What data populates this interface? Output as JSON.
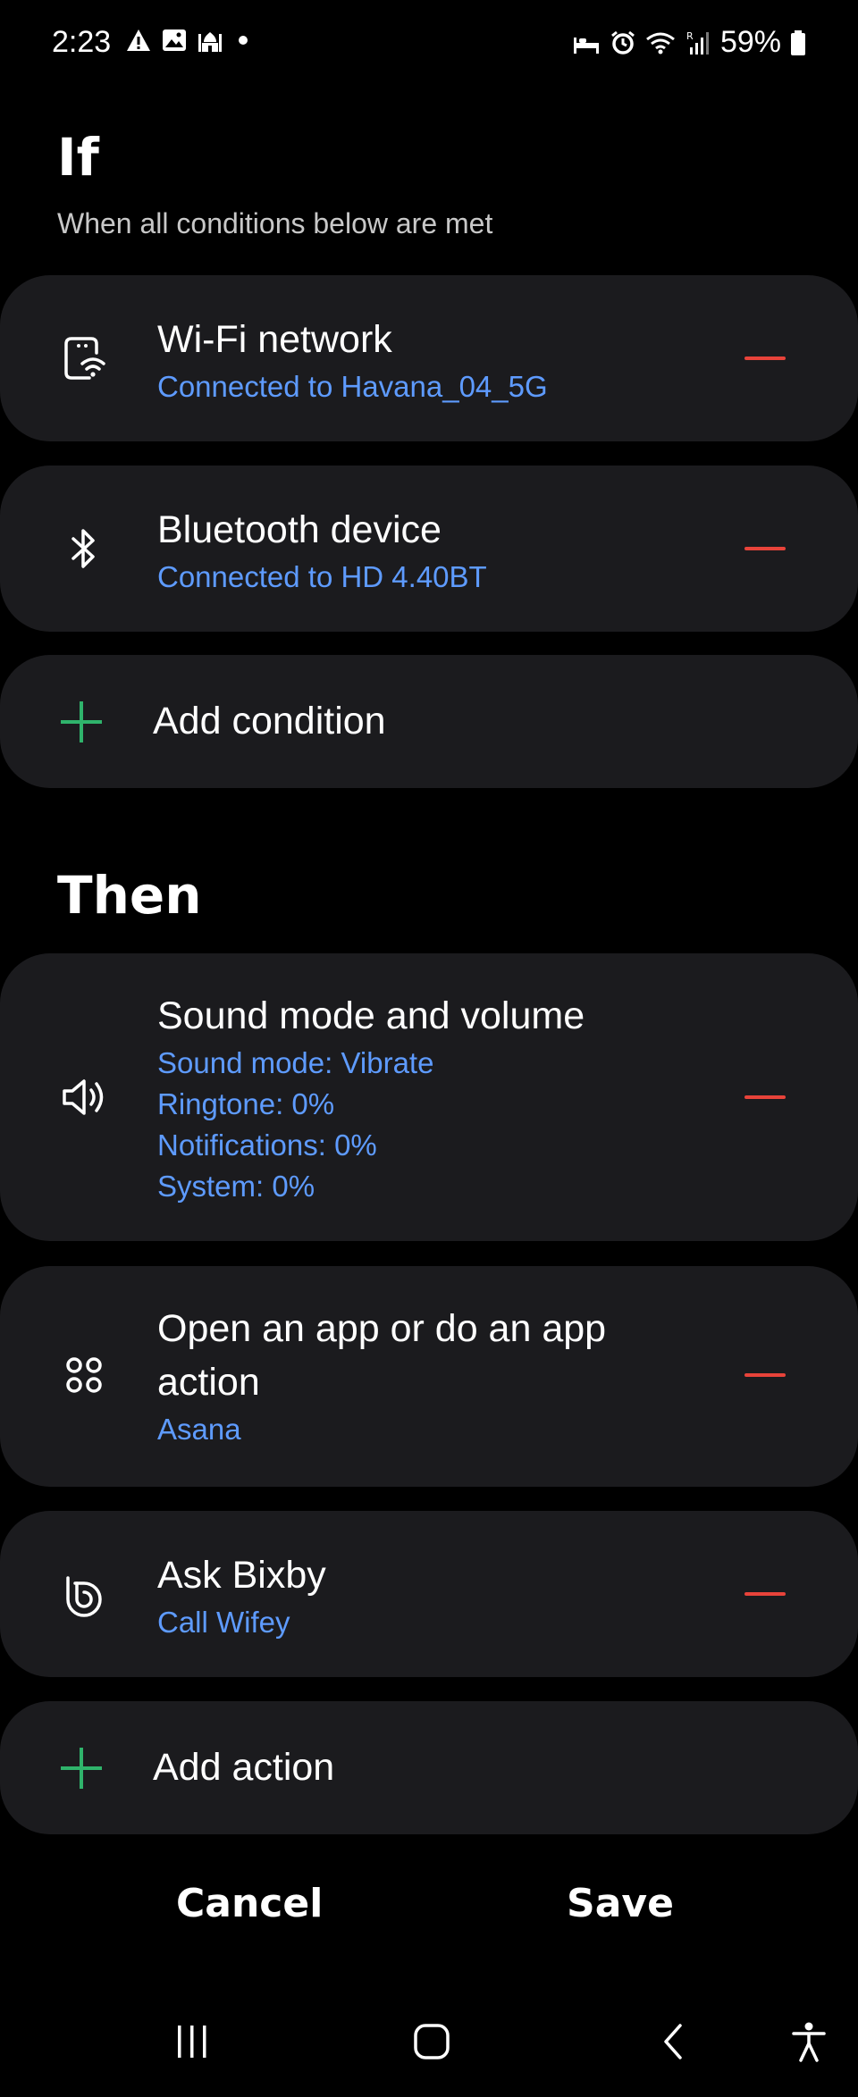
{
  "status_bar": {
    "time": "2:23",
    "battery": "59%",
    "icons_left": [
      "warning-icon",
      "image-icon",
      "mosque-icon",
      "dot-icon"
    ],
    "icons_right": [
      "sleep-icon",
      "alarm-icon",
      "wifi-icon",
      "signal-icon",
      "battery-icon"
    ]
  },
  "if_section": {
    "title": "If",
    "subtitle": "When all conditions below are met",
    "conditions": [
      {
        "title": "Wi-Fi network",
        "detail": "Connected to Havana_04_5G",
        "icon": "wifi-phone-icon"
      },
      {
        "title": "Bluetooth device",
        "detail": "Connected to HD 4.40BT",
        "icon": "bluetooth-icon"
      }
    ],
    "add_label": "Add condition"
  },
  "then_section": {
    "title": "Then",
    "actions": [
      {
        "title": "Sound mode and volume",
        "details": [
          "Sound mode: Vibrate",
          "Ringtone: 0%",
          "Notifications: 0%",
          "System: 0%"
        ],
        "icon": "speaker-icon"
      },
      {
        "title_lines": [
          "Open an app or do an app",
          "action"
        ],
        "details": [
          "Asana"
        ],
        "icon": "apps-icon"
      },
      {
        "title": "Ask Bixby",
        "details": [
          "Call Wifey"
        ],
        "icon": "bixby-icon"
      }
    ],
    "add_label": "Add action"
  },
  "footer": {
    "cancel_label": "Cancel",
    "save_label": "Save"
  },
  "colors": {
    "background": "#000000",
    "card": "#1b1b1e",
    "accent_blue": "#5e9bff",
    "remove_red": "#e8433a",
    "add_green": "#2fb36b"
  }
}
